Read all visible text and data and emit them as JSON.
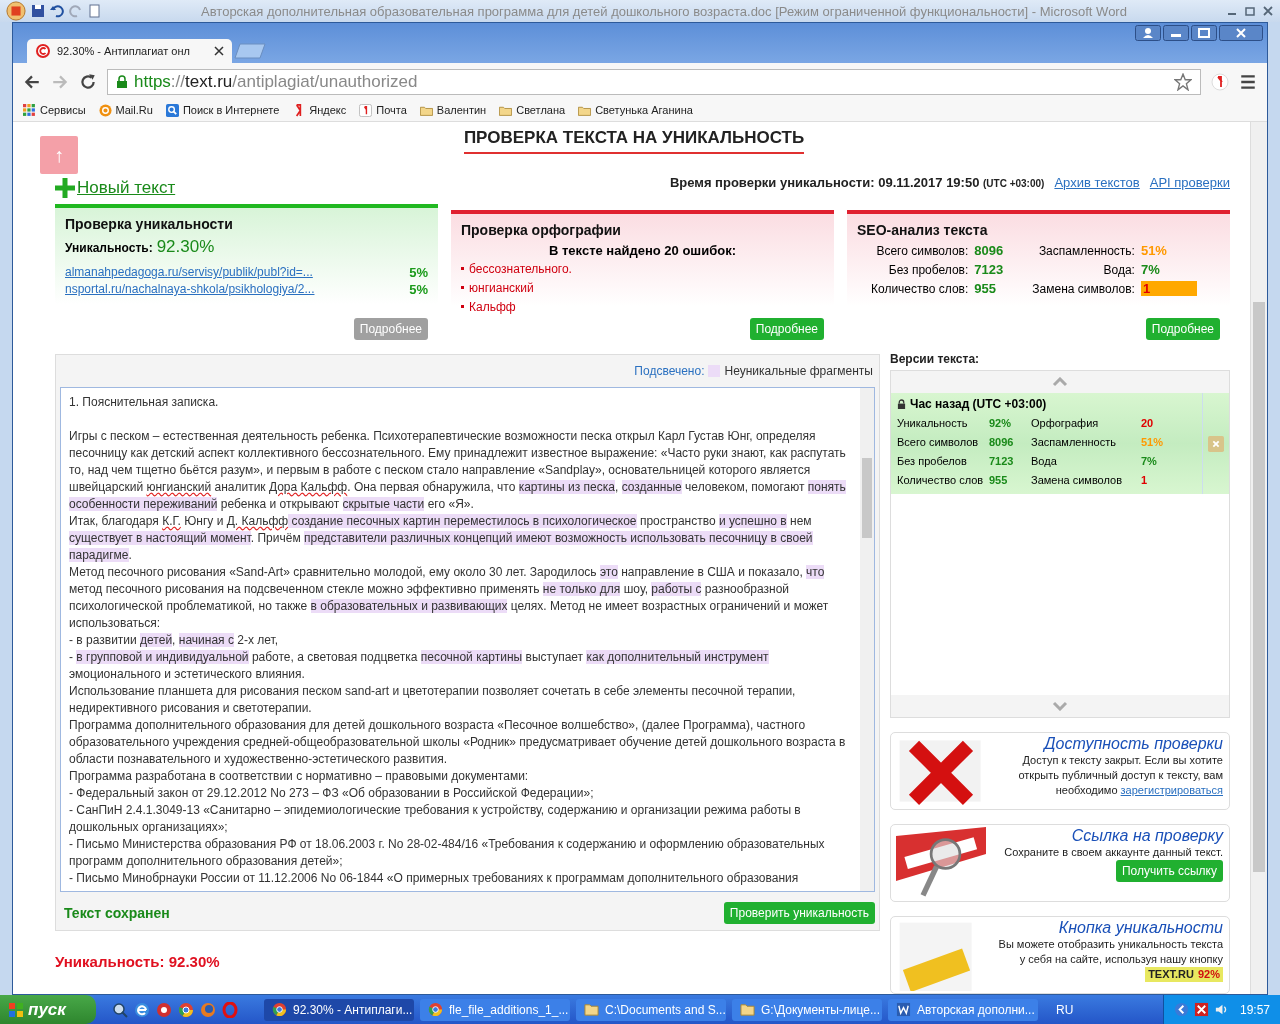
{
  "word_window": {
    "title": "Авторская дополнительная образовательная программа для детей дошкольного возраста.doc [Режим ограниченной функциональности] - Microsoft Word"
  },
  "browser": {
    "tabs": [
      {
        "title": "92.30% - Антиплагиат онл",
        "selected": true
      }
    ],
    "url": {
      "scheme": "https",
      "separator": "://",
      "host": "text.ru",
      "path": "/antiplagiat/unauthorized"
    },
    "bookmarks": [
      {
        "label": "Сервисы",
        "kind": "apps"
      },
      {
        "label": "Mail.Ru",
        "kind": "mail"
      },
      {
        "label": "Поиск в Интернете",
        "kind": "search"
      },
      {
        "label": "Яндекс",
        "kind": "yandex"
      },
      {
        "label": "Почта",
        "kind": "yandex-mail"
      },
      {
        "label": "Валентин",
        "kind": "folder"
      },
      {
        "label": "Светлана",
        "kind": "folder"
      },
      {
        "label": "Светунька Аганина",
        "kind": "folder"
      }
    ]
  },
  "page": {
    "heading": "ПРОВЕРКА ТЕКСТА НА УНИКАЛЬНОСТЬ",
    "scroll_top": "↑",
    "new_text": "Новый текст",
    "check_time": {
      "label": "Время проверки уникальности: 09.11.2017 19:50",
      "zone": "(UTC +03:00)"
    },
    "links": [
      "Архив текстов",
      "API проверки"
    ],
    "uniqueness_card": {
      "title": "Проверка уникальности",
      "label": "Уникальность:",
      "value": "92.30%",
      "sources": [
        {
          "url": "almanahpedagoga.ru/servisy/publik/publ?id=...",
          "percent": "5%"
        },
        {
          "url": "nsportal.ru/nachalnaya-shkola/psikhologiya/2...",
          "percent": "5%"
        }
      ],
      "button": {
        "label": "Подробнее",
        "disabled": true
      }
    },
    "spelling_card": {
      "title": "Проверка орфографии",
      "summary": "В тексте найдено 20 ошибок:",
      "errors": [
        "бессознательного.",
        "юнгианский",
        "Кальфф"
      ],
      "button": {
        "label": "Подробнее",
        "disabled": false
      }
    },
    "seo_card": {
      "title": "SEO-анализ текста",
      "left": [
        {
          "label": "Всего символов:",
          "value": "8096"
        },
        {
          "label": "Без пробелов:",
          "value": "7123"
        },
        {
          "label": "Количество слов:",
          "value": "955"
        }
      ],
      "right": [
        {
          "label": "Заспамленность:",
          "value": "51%",
          "color": "#ff9900",
          "highlighted": false
        },
        {
          "label": "Вода:",
          "value": "7%",
          "color": "#1a8a1a",
          "highlighted": false
        },
        {
          "label": "Замена символов:",
          "value": "1",
          "highlighted": true
        }
      ],
      "button": {
        "label": "Подробнее",
        "disabled": false
      }
    },
    "legend": {
      "label": "Подсвечено:",
      "text": "Неуникальные фрагменты"
    },
    "text": [
      [
        {
          "text": "1. Пояснительная записка.",
          "kind": "plain"
        }
      ],
      [
        {
          "text": "Игры с песком – естественная деятельность ребенка. Психотерапевтические возможности песка открыл Карл Густав Юнг, определяя песочницу как детский аспект коллективного бессознательного. Ему принадлежит известное выражение: «Часто руки знают, как распутать то, над чем тщетно бьётся разум», и первым в работе с песком стало направление «Sandplay», основательницей которого является швейцарский ",
          "kind": "plain"
        },
        {
          "text": "юнгианский",
          "kind": "misspelled"
        },
        {
          "text": " аналитик ",
          "kind": "plain"
        },
        {
          "text": "Дора Кальфф",
          "kind": "misspelled"
        },
        {
          "text": ". Она первая обнаружила, что ",
          "kind": "plain"
        },
        {
          "text": "картины из песка",
          "kind": "highlight"
        },
        {
          "text": ", ",
          "kind": "plain"
        },
        {
          "text": "созданные",
          "kind": "highlight"
        },
        {
          "text": " человеком, помогают ",
          "kind": "plain"
        },
        {
          "text": "понять особенности переживаний",
          "kind": "highlight"
        },
        {
          "text": " ребенка и открывают ",
          "kind": "plain"
        },
        {
          "text": "скрытые части",
          "kind": "highlight"
        },
        {
          "text": " его «Я».",
          "kind": "plain"
        }
      ],
      [
        {
          "text": "Итак, благодаря ",
          "kind": "plain"
        },
        {
          "text": "К.Г.",
          "kind": "misspelled"
        },
        {
          "text": " Юнгу и ",
          "kind": "plain"
        },
        {
          "text": "Д. Кальфф",
          "kind": "misspelled"
        },
        {
          "text": " создание песочных картин переместилось в психологическое",
          "kind": "highlight"
        },
        {
          "text": " пространство ",
          "kind": "plain"
        },
        {
          "text": "и успешно в",
          "kind": "highlight"
        },
        {
          "text": " нем ",
          "kind": "plain"
        },
        {
          "text": "существует в настоящий момент",
          "kind": "highlight"
        },
        {
          "text": ". Причём ",
          "kind": "plain"
        },
        {
          "text": "представители различных концепций имеют возможность использовать песочницу в своей парадигме",
          "kind": "highlight"
        },
        {
          "text": ".",
          "kind": "plain"
        }
      ],
      [
        {
          "text": "Метод песочного рисования «Sand-Art» сравнительно молодой, ему около 30 лет. Зародилось ",
          "kind": "plain"
        },
        {
          "text": "это",
          "kind": "highlight"
        },
        {
          "text": " направление в США и показало, ",
          "kind": "plain"
        },
        {
          "text": "что",
          "kind": "highlight"
        },
        {
          "text": " метод песочного рисования на подсвеченном стекле можно эффективно применять ",
          "kind": "plain"
        },
        {
          "text": "не только для",
          "kind": "highlight"
        },
        {
          "text": " шоу, ",
          "kind": "plain"
        },
        {
          "text": "работы с",
          "kind": "highlight"
        },
        {
          "text": " разнообразной психологической проблематикой, но также ",
          "kind": "plain"
        },
        {
          "text": "в образовательных и развивающих",
          "kind": "highlight"
        },
        {
          "text": " целях. Метод не имеет возрастных ограничений и может использоваться:",
          "kind": "plain"
        }
      ],
      [
        {
          "text": "- в развитии ",
          "kind": "plain"
        },
        {
          "text": "детей",
          "kind": "highlight"
        },
        {
          "text": ", ",
          "kind": "plain"
        },
        {
          "text": "начиная с",
          "kind": "highlight"
        },
        {
          "text": " 2-х лет,",
          "kind": "plain"
        }
      ],
      [
        {
          "text": "- ",
          "kind": "plain"
        },
        {
          "text": "в групповой и индивидуальной",
          "kind": "highlight"
        },
        {
          "text": " работе, а световая подцветка ",
          "kind": "plain"
        },
        {
          "text": "песочной картины",
          "kind": "highlight"
        },
        {
          "text": " выступает ",
          "kind": "plain"
        },
        {
          "text": "как дополнительный инструмент",
          "kind": "highlight"
        },
        {
          "text": " эмоционального и эстетического влияния.",
          "kind": "plain"
        }
      ],
      [
        {
          "text": "Использование планшета для рисования песком sand-art и цветотерапии позволяет сочетать в себе элементы песочной терапии, недирективного рисования и светотерапии.",
          "kind": "plain"
        }
      ],
      [
        {
          "text": "Программа дополнительного образования для детей дошкольного возраста «Песочное волшебство», (далее Программа), частного образовательного учреждения средней-общеобразовательной школы «Родник» предусматривает обучение детей дошкольного возраста в области познавательного и художественно-эстетического развития.",
          "kind": "plain"
        }
      ],
      [
        {
          "text": "Программа разработана в соответствии с нормативно – правовыми документами:",
          "kind": "plain"
        }
      ],
      [
        {
          "text": "- Федеральный закон от 29.12.2012 No 273 – ФЗ «Об образовании в Российской Федерации»;",
          "kind": "plain"
        }
      ],
      [
        {
          "text": "- СанПиН 2.4.1.3049-13 «Санитарно – эпидемиологические требования к устройству, содержанию и организации режима работы в дошкольных организациях»;",
          "kind": "plain"
        }
      ],
      [
        {
          "text": "- Письмо Министерства образования РФ от 18.06.2003 г. No 28-02-484/16 «Требования к содержанию и оформлению образовательных программ дополнительного образования детей»;",
          "kind": "plain"
        }
      ],
      [
        {
          "text": "- Письмо Минобрнауки России от 11.12.2006 No 06-1844 «О примерных требованиях к программам дополнительного образования",
          "kind": "plain"
        }
      ]
    ],
    "status": "Текст сохранен",
    "check_button": "Проверить уникальность",
    "result": "Уникальность: 92.30%",
    "versions": {
      "title": "Версии текста:",
      "items": [
        {
          "time": "Час назад (UTC +03:00)",
          "selected": true,
          "rows": [
            {
              "cells": [
                {
                  "label": "Уникальность",
                  "value": "92%",
                  "color": "#1a8a1a"
                },
                {
                  "label": "Орфография",
                  "value": "20",
                  "color": "#e00000"
                }
              ]
            },
            {
              "cells": [
                {
                  "label": "Всего символов",
                  "value": "8096",
                  "color": "#1a8a1a"
                },
                {
                  "label": "Заспамленность",
                  "value": "51%",
                  "color": "#ff9900"
                }
              ]
            },
            {
              "cells": [
                {
                  "label": "Без пробелов",
                  "value": "7123",
                  "color": "#1a8a1a"
                },
                {
                  "label": "Вода",
                  "value": "7%",
                  "color": "#1a8a1a"
                }
              ]
            },
            {
              "cells": [
                {
                  "label": "Количество слов",
                  "value": "955",
                  "color": "#1a8a1a"
                },
                {
                  "label": "Замена символов",
                  "value": "1",
                  "color": "#e00000"
                }
              ]
            }
          ]
        }
      ]
    },
    "promos": [
      {
        "kind": "access",
        "title": "Доступность проверки",
        "text": "Доступ к тексту закрыт. Если вы хотите открыть публичный доступ к тексту, вам необходимо",
        "link": "зарегистрироваться"
      },
      {
        "kind": "link",
        "title": "Ссылка на проверку",
        "text": "Сохраните в своем аккаунте данный текст.",
        "button": "Получить ссылку"
      },
      {
        "kind": "badge",
        "title": "Кнопка уникальности",
        "text": "Вы можете отобразить уникальность текста у себя на сайте, используя нашу кнопку",
        "badge_name": "TEXT.RU",
        "badge_value": "92%"
      }
    ]
  },
  "taskbar": {
    "start": "пуск",
    "tasks": [
      {
        "label": "92.30% - Антиплаги...",
        "kind": "chrome",
        "selected": true
      },
      {
        "label": "fle_file_additions_1_...",
        "kind": "chrome",
        "selected": false
      },
      {
        "label": "C:\\Documents and S...",
        "kind": "folder",
        "selected": false
      },
      {
        "label": "G:\\Документы-лице...",
        "kind": "folder",
        "selected": false
      },
      {
        "label": "Авторская дополни...",
        "kind": "word",
        "selected": false
      }
    ],
    "language": "RU",
    "clock": "19:57"
  }
}
